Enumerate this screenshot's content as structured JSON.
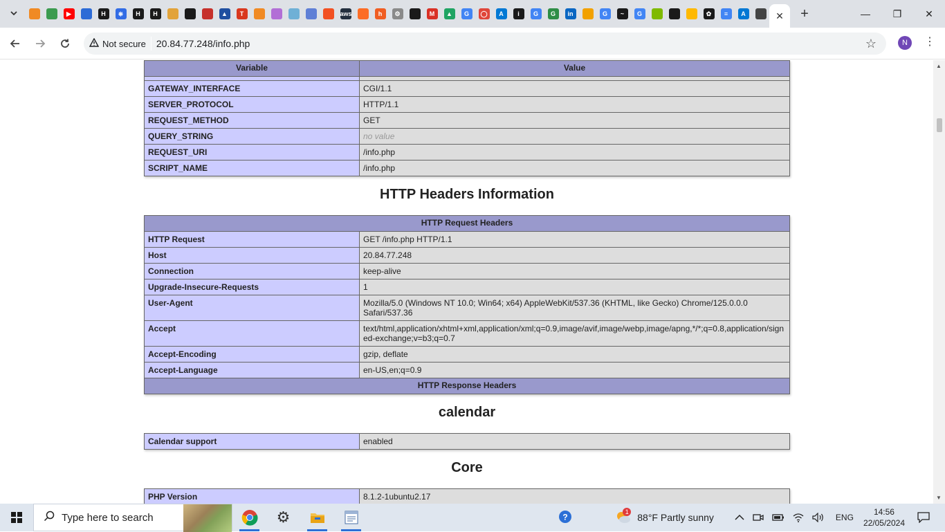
{
  "browser": {
    "tab_search_icon": "chevron-down-icon",
    "favicons": [
      {
        "name": "box-icon",
        "color": "#f08a24",
        "glyph": ""
      },
      {
        "name": "cloud-shell-icon",
        "color": "#3b9b4f",
        "glyph": ""
      },
      {
        "name": "youtube-icon",
        "color": "#ff0000",
        "glyph": "▶"
      },
      {
        "name": "power-automate-icon",
        "color": "#2c6bd6",
        "glyph": ""
      },
      {
        "name": "hacker-icon",
        "color": "#1a1a1a",
        "glyph": "H"
      },
      {
        "name": "kubernetes-icon",
        "color": "#326ce5",
        "glyph": "⎈"
      },
      {
        "name": "hacker-icon-2",
        "color": "#1a1a1a",
        "glyph": "H"
      },
      {
        "name": "hacker-icon-3",
        "color": "#1a1a1a",
        "glyph": "H"
      },
      {
        "name": "package-icon",
        "color": "#e2a33a",
        "glyph": ""
      },
      {
        "name": "github-icon",
        "color": "#1a1a1a",
        "glyph": ""
      },
      {
        "name": "redis-icon",
        "color": "#c6302b",
        "glyph": ""
      },
      {
        "name": "azure-devops-icon",
        "color": "#1f4fa0",
        "glyph": "▲"
      },
      {
        "name": "t-icon",
        "color": "#d9381e",
        "glyph": "T"
      },
      {
        "name": "box-icon-2",
        "color": "#f08a24",
        "glyph": ""
      },
      {
        "name": "cube-icon",
        "color": "#b26fd6",
        "glyph": ""
      },
      {
        "name": "cube-icon-2",
        "color": "#6fb0d6",
        "glyph": ""
      },
      {
        "name": "grid-icon",
        "color": "#5f7fd6",
        "glyph": ""
      },
      {
        "name": "microsoft-icon",
        "color": "#f25022",
        "glyph": ""
      },
      {
        "name": "aws-icon",
        "color": "#232f3e",
        "glyph": "aws"
      },
      {
        "name": "gitlab-icon",
        "color": "#fc6d26",
        "glyph": ""
      },
      {
        "name": "hackerrank-icon",
        "color": "#f05d22",
        "glyph": "h"
      },
      {
        "name": "gear-icon",
        "color": "#8a8a8a",
        "glyph": "⚙"
      },
      {
        "name": "feather-icon",
        "color": "#1a1a1a",
        "glyph": ""
      },
      {
        "name": "gmail-icon",
        "color": "#d93025",
        "glyph": "M"
      },
      {
        "name": "drive-icon",
        "color": "#1fa463",
        "glyph": "▲"
      },
      {
        "name": "google-icon",
        "color": "#4285f4",
        "glyph": "G"
      },
      {
        "name": "oval-icon",
        "color": "#e0463a",
        "glyph": "◯"
      },
      {
        "name": "azure-icon",
        "color": "#0078d4",
        "glyph": "A"
      },
      {
        "name": "info-icon",
        "color": "#1a1a1a",
        "glyph": "i"
      },
      {
        "name": "google-icon-2",
        "color": "#4285f4",
        "glyph": "G"
      },
      {
        "name": "geeks-icon",
        "color": "#2f8d46",
        "glyph": "G"
      },
      {
        "name": "linkedin-icon",
        "color": "#0a66c2",
        "glyph": "in"
      },
      {
        "name": "cloud-icon",
        "color": "#f2a100",
        "glyph": ""
      },
      {
        "name": "google-icon-3",
        "color": "#4285f4",
        "glyph": "G"
      },
      {
        "name": "chart-icon",
        "color": "#1a1a1a",
        "glyph": "~"
      },
      {
        "name": "google-icon-4",
        "color": "#4285f4",
        "glyph": "G"
      },
      {
        "name": "microsoft-icon-2",
        "color": "#7fba00",
        "glyph": ""
      },
      {
        "name": "github-icon-2",
        "color": "#1a1a1a",
        "glyph": ""
      },
      {
        "name": "microsoft-icon-3",
        "color": "#ffb900",
        "glyph": ""
      },
      {
        "name": "openai-icon",
        "color": "#1a1a1a",
        "glyph": "✿"
      },
      {
        "name": "docs-icon",
        "color": "#4285f4",
        "glyph": "≡"
      },
      {
        "name": "azure-icon-2",
        "color": "#0078d4",
        "glyph": "A"
      },
      {
        "name": "penguin-icon",
        "color": "#444444",
        "glyph": ""
      }
    ],
    "active_tab_close": "✕",
    "new_tab": "+",
    "window_controls": [
      "—",
      "❐",
      "✕"
    ],
    "security_label": "Not secure",
    "url": "20.84.77.248/info.php",
    "profile_initial": "N"
  },
  "page": {
    "env_table": {
      "headers": [
        "Variable",
        "Value"
      ],
      "rows": [
        {
          "k": "GATEWAY_INTERFACE",
          "v": "CGI/1.1"
        },
        {
          "k": "SERVER_PROTOCOL",
          "v": "HTTP/1.1"
        },
        {
          "k": "REQUEST_METHOD",
          "v": "GET"
        },
        {
          "k": "QUERY_STRING",
          "v": "no value"
        },
        {
          "k": "REQUEST_URI",
          "v": "/info.php"
        },
        {
          "k": "SCRIPT_NAME",
          "v": "/info.php"
        }
      ]
    },
    "http_heading": "HTTP Headers Information",
    "http_table": {
      "request_header": "HTTP Request Headers",
      "rows": [
        {
          "k": "HTTP Request",
          "v": "GET /info.php HTTP/1.1"
        },
        {
          "k": "Host",
          "v": "20.84.77.248"
        },
        {
          "k": "Connection",
          "v": "keep-alive"
        },
        {
          "k": "Upgrade-Insecure-Requests",
          "v": "1"
        },
        {
          "k": "User-Agent",
          "v": "Mozilla/5.0 (Windows NT 10.0; Win64; x64) AppleWebKit/537.36 (KHTML, like Gecko) Chrome/125.0.0.0 Safari/537.36"
        },
        {
          "k": "Accept",
          "v": "text/html,application/xhtml+xml,application/xml;q=0.9,image/avif,image/webp,image/apng,*/*;q=0.8,application/signed-exchange;v=b3;q=0.7"
        },
        {
          "k": "Accept-Encoding",
          "v": "gzip, deflate"
        },
        {
          "k": "Accept-Language",
          "v": "en-US,en;q=0.9"
        }
      ],
      "response_header": "HTTP Response Headers"
    },
    "calendar_heading": "calendar",
    "calendar_rows": [
      {
        "k": "Calendar support",
        "v": "enabled"
      }
    ],
    "core_heading": "Core",
    "core_rows": [
      {
        "k": "PHP Version",
        "v": "8.1.2-1ubuntu2.17"
      }
    ]
  },
  "taskbar": {
    "search_placeholder": "Type here to search",
    "weather": "88°F  Partly sunny",
    "weather_badge": "1",
    "language": "ENG",
    "time": "14:56",
    "date": "22/05/2024"
  },
  "colors": {
    "php_header": "#9999cc",
    "php_key": "#ccccff",
    "php_value": "#dddddd"
  }
}
